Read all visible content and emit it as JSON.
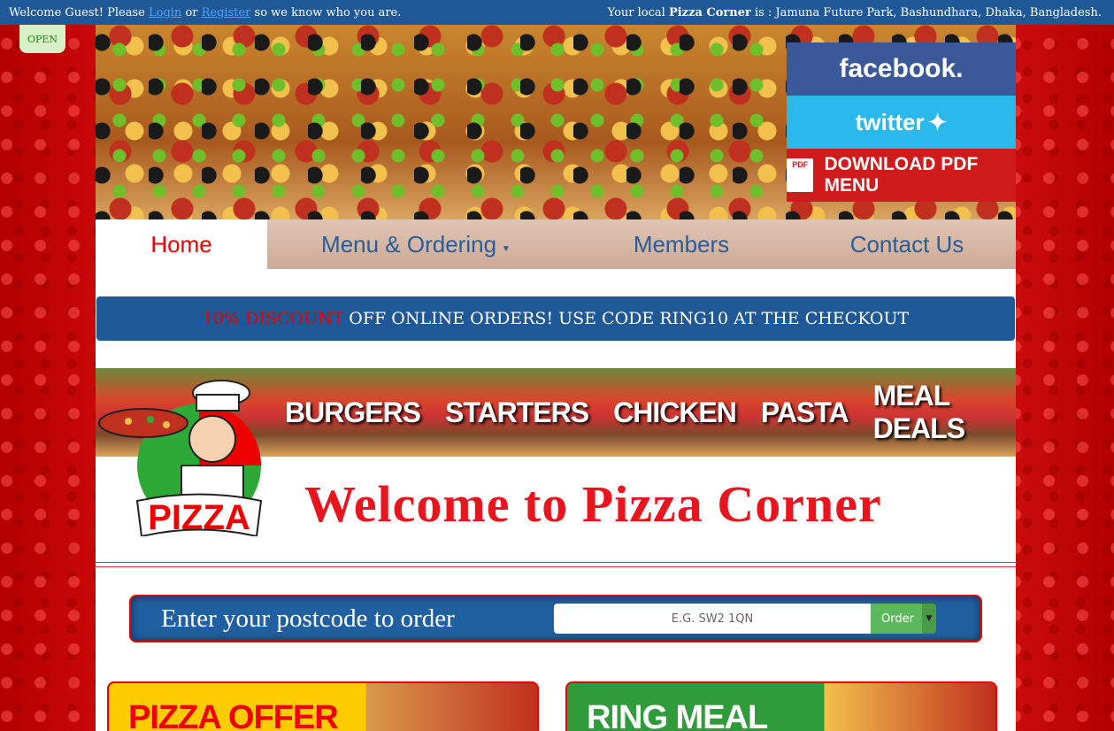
{
  "topbar": {
    "welcome_prefix": "Welcome Guest! Please",
    "login_link": "Login",
    "or_text": "or",
    "register_link": "Register",
    "welcome_suffix": "so we know who you are.",
    "location_prefix": "Your local",
    "store_name": "Pizza Corner",
    "location_mid": "is :",
    "address": "Jamuna Future Park, Bashundhara, Dhaka, Bangladesh."
  },
  "status_badge": "OPEN",
  "social": {
    "facebook": "facebook.",
    "twitter": "twitter",
    "pdf_icon": "PDF",
    "pdf_label": "DOWNLOAD PDF MENU"
  },
  "nav": {
    "home": "Home",
    "menu": "Menu & Ordering",
    "members": "Members",
    "contact": "Contact Us"
  },
  "promo": {
    "highlight": "10% DISCOUNT",
    "text": "OFF ONLINE ORDERS! USE CODE RING10 AT THE CHECKOUT"
  },
  "categories": [
    "BURGERS",
    "STARTERS",
    "CHICKEN",
    "PASTA",
    "MEAL DEALS"
  ],
  "mascot_text": "PIZZA",
  "welcome_title": "Welcome to Pizza Corner",
  "postcode": {
    "label": "Enter your postcode to order",
    "placeholder": "E.G. SW2 1QN",
    "button": "Order"
  },
  "cards": {
    "pizza_offer": "PIZZA OFFER",
    "ring_meal": "RING MEAL"
  },
  "colors": {
    "brand_blue": "#1f5896",
    "brand_red": "#e8141e",
    "order_green": "#5cb85c"
  }
}
